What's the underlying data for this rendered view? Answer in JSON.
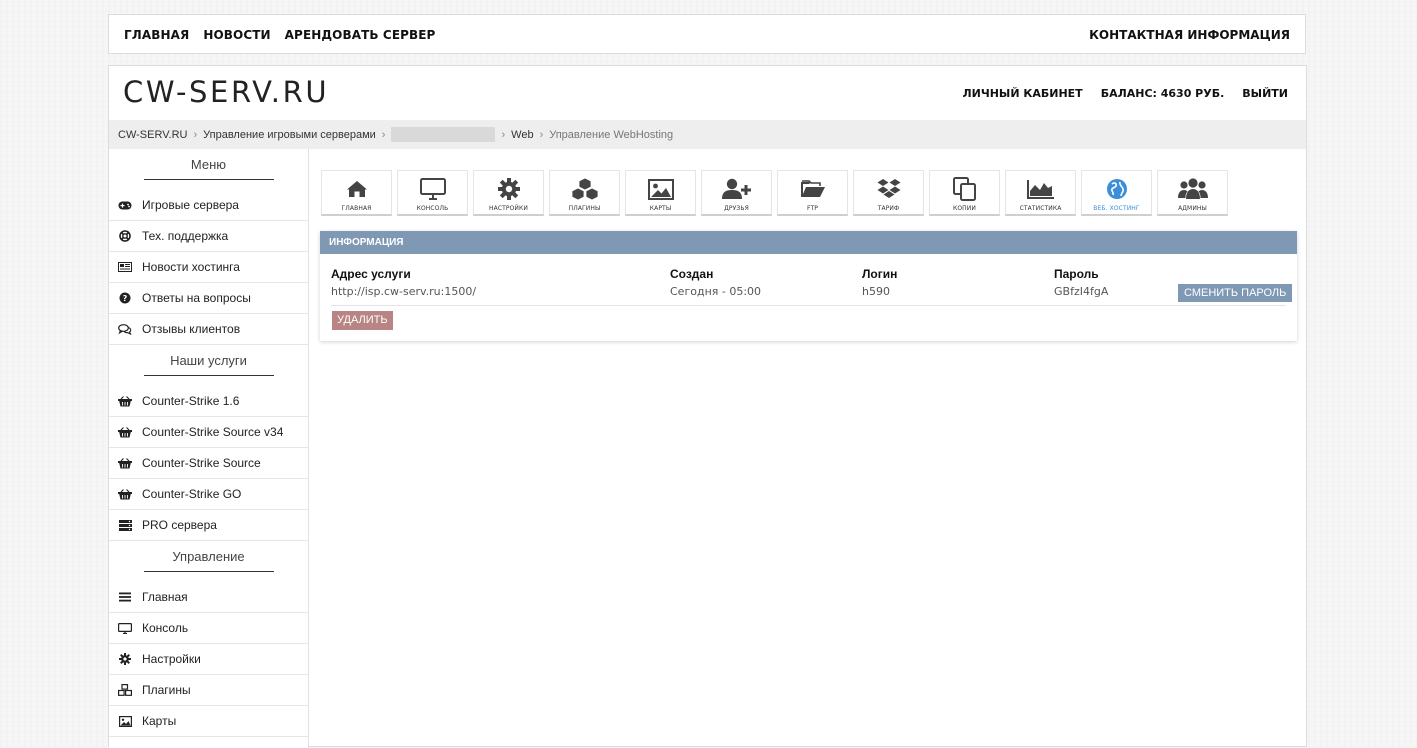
{
  "topnav": {
    "items": [
      "ГЛАВНАЯ",
      "НОВОСТИ",
      "АРЕНДОВАТЬ СЕРВЕР"
    ],
    "contact": "КОНТАКТНАЯ ИНФОРМАЦИЯ"
  },
  "header": {
    "logo": "CW-SERV.RU",
    "account": "ЛИЧНЫЙ КАБИНЕТ",
    "balance": "БАЛАНС: 4630 РУБ.",
    "logout": "ВЫЙТИ"
  },
  "breadcrumb": {
    "home": "CW-SERV.RU",
    "game_servers": "Управление игровыми серверами",
    "web": "Web",
    "current": "Управление WebHosting"
  },
  "sidebar": {
    "menu_title": "Меню",
    "menu": [
      {
        "label": "Игровые сервера",
        "icon": "gamepad-icon"
      },
      {
        "label": "Тех. поддержка",
        "icon": "lifebuoy-icon"
      },
      {
        "label": "Новости хостинга",
        "icon": "newspaper-icon"
      },
      {
        "label": "Ответы на вопросы",
        "icon": "question-icon"
      },
      {
        "label": "Отзывы клиентов",
        "icon": "comments-icon"
      }
    ],
    "services_title": "Наши услуги",
    "services": [
      {
        "label": "Counter-Strike 1.6",
        "icon": "basket-icon"
      },
      {
        "label": "Counter-Strike Source v34",
        "icon": "basket-icon"
      },
      {
        "label": "Counter-Strike Source",
        "icon": "basket-icon"
      },
      {
        "label": "Counter-Strike GO",
        "icon": "basket-icon"
      },
      {
        "label": "PRO сервера",
        "icon": "server-icon"
      }
    ],
    "manage_title": "Управление",
    "manage": [
      {
        "label": "Главная",
        "icon": "list-icon"
      },
      {
        "label": "Консоль",
        "icon": "monitor-icon"
      },
      {
        "label": "Настройки",
        "icon": "gear-icon"
      },
      {
        "label": "Плагины",
        "icon": "cubes-icon"
      },
      {
        "label": "Карты",
        "icon": "image-icon"
      }
    ]
  },
  "toolbar": {
    "items": [
      {
        "label": "ГЛАВНАЯ",
        "icon": "home-icon"
      },
      {
        "label": "КОНСОЛЬ",
        "icon": "monitor-icon"
      },
      {
        "label": "НАСТРОЙКИ",
        "icon": "gear-icon"
      },
      {
        "label": "ПЛАГИНЫ",
        "icon": "cubes-icon"
      },
      {
        "label": "КАРТЫ",
        "icon": "image-icon"
      },
      {
        "label": "ДРУЗЬЯ",
        "icon": "user-plus-icon"
      },
      {
        "label": "FTP",
        "icon": "folder-icon"
      },
      {
        "label": "ТАРИФ",
        "icon": "dropbox-icon"
      },
      {
        "label": "КОПИИ",
        "icon": "copy-icon"
      },
      {
        "label": "СТАТИСТИКА",
        "icon": "area-chart-icon"
      },
      {
        "label": "ВЕБ. ХОСТИНГ",
        "icon": "globe-icon"
      },
      {
        "label": "АДМИНЫ",
        "icon": "users-icon"
      }
    ],
    "active_color": "#3a8fd8"
  },
  "info": {
    "title": "ИНФОРМАЦИЯ",
    "address_label": "Адрес услуги",
    "address_value": "http://isp.cw-serv.ru:1500/",
    "created_label": "Создан",
    "created_value": "Сегодня - 05:00",
    "login_label": "Логин",
    "login_value": "h590",
    "password_label": "Пароль",
    "password_value": "GBfzI4fgA",
    "change_password": "СМЕНИТЬ ПАРОЛЬ",
    "delete": "УДАЛИТЬ"
  },
  "colors": {
    "panel_header": "#7f98b4",
    "delete_button": "#b98484"
  }
}
